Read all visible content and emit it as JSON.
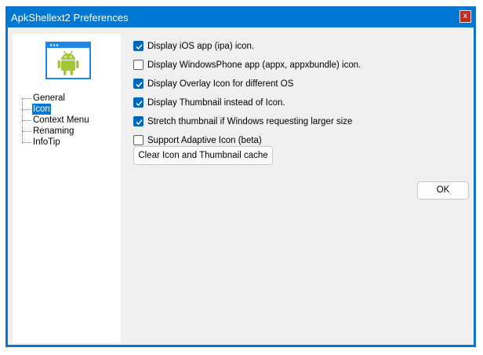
{
  "window": {
    "title": "ApkShellext2 Preferences",
    "close_glyph": "x"
  },
  "app_icon": {
    "name": "android-window-icon",
    "color": "#a4c639"
  },
  "tree": {
    "items": [
      {
        "label": "General",
        "selected": false
      },
      {
        "label": "Icon",
        "selected": true
      },
      {
        "label": "Context Menu",
        "selected": false
      },
      {
        "label": "Renaming",
        "selected": false
      },
      {
        "label": "InfoTip",
        "selected": false
      }
    ]
  },
  "options": [
    {
      "label": "Display iOS app (ipa) icon.",
      "checked": true
    },
    {
      "label": "Display WindowsPhone app (appx, appxbundle) icon.",
      "checked": false
    },
    {
      "label": "Display Overlay Icon for different OS",
      "checked": true
    },
    {
      "label": "Display Thumbnail instead of Icon.",
      "checked": true
    },
    {
      "label": "Stretch thumbnail if Windows requesting larger size",
      "checked": true
    },
    {
      "label": "Support Adaptive Icon (beta)",
      "checked": false
    }
  ],
  "buttons": {
    "clear_cache": "Clear Icon and Thumbnail cache",
    "ok": "OK"
  },
  "colors": {
    "accent": "#0078d4",
    "close": "#c42b1c",
    "checkbox": "#0067c0"
  }
}
